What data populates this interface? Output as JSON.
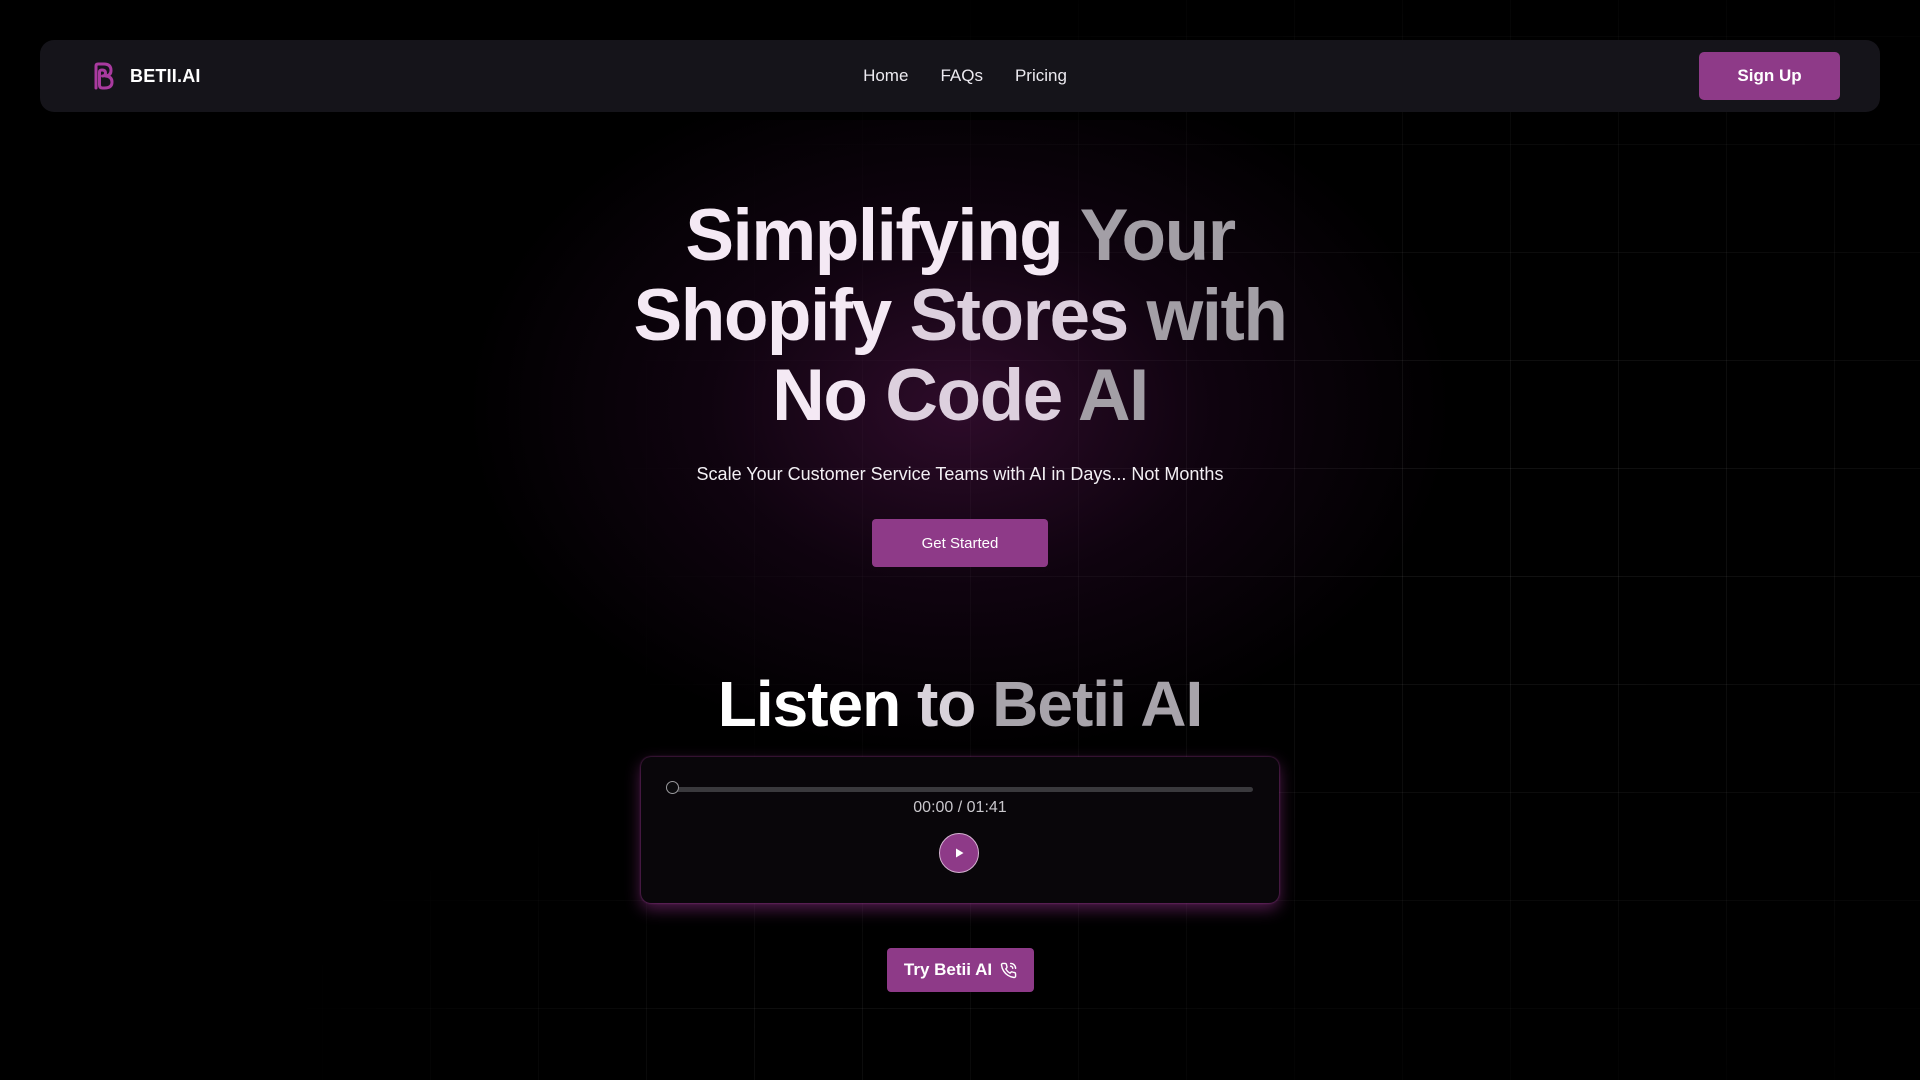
{
  "nav": {
    "brand": "BETII.AI",
    "logo_icon": "betii-logo-icon",
    "links": [
      "Home",
      "FAQs",
      "Pricing"
    ],
    "signup_label": "Sign Up"
  },
  "hero": {
    "title_line1_a": "Simplifying",
    "title_line1_b": "Your",
    "title_line2_a": "Shopify",
    "title_line2_b": "Stores",
    "title_line2_c": "with",
    "title_line3_a": "No",
    "title_line3_b": "Code",
    "title_line3_c": "AI",
    "subtitle": "Scale Your Customer Service Teams with AI in Days... Not Months",
    "cta_label": "Get Started"
  },
  "listen": {
    "title_a": "Listen",
    "title_b": "to",
    "title_c": "Betii AI"
  },
  "player": {
    "current_time": "00:00",
    "duration": "01:41",
    "time_display": "00:00 / 01:41",
    "progress": 0,
    "play_icon": "play-icon"
  },
  "try_button": {
    "label": "Try Betii AI",
    "icon": "phone-call-icon"
  },
  "colors": {
    "background": "#000000",
    "accent": "#8e3a88",
    "nav_bg": "#15141a"
  }
}
